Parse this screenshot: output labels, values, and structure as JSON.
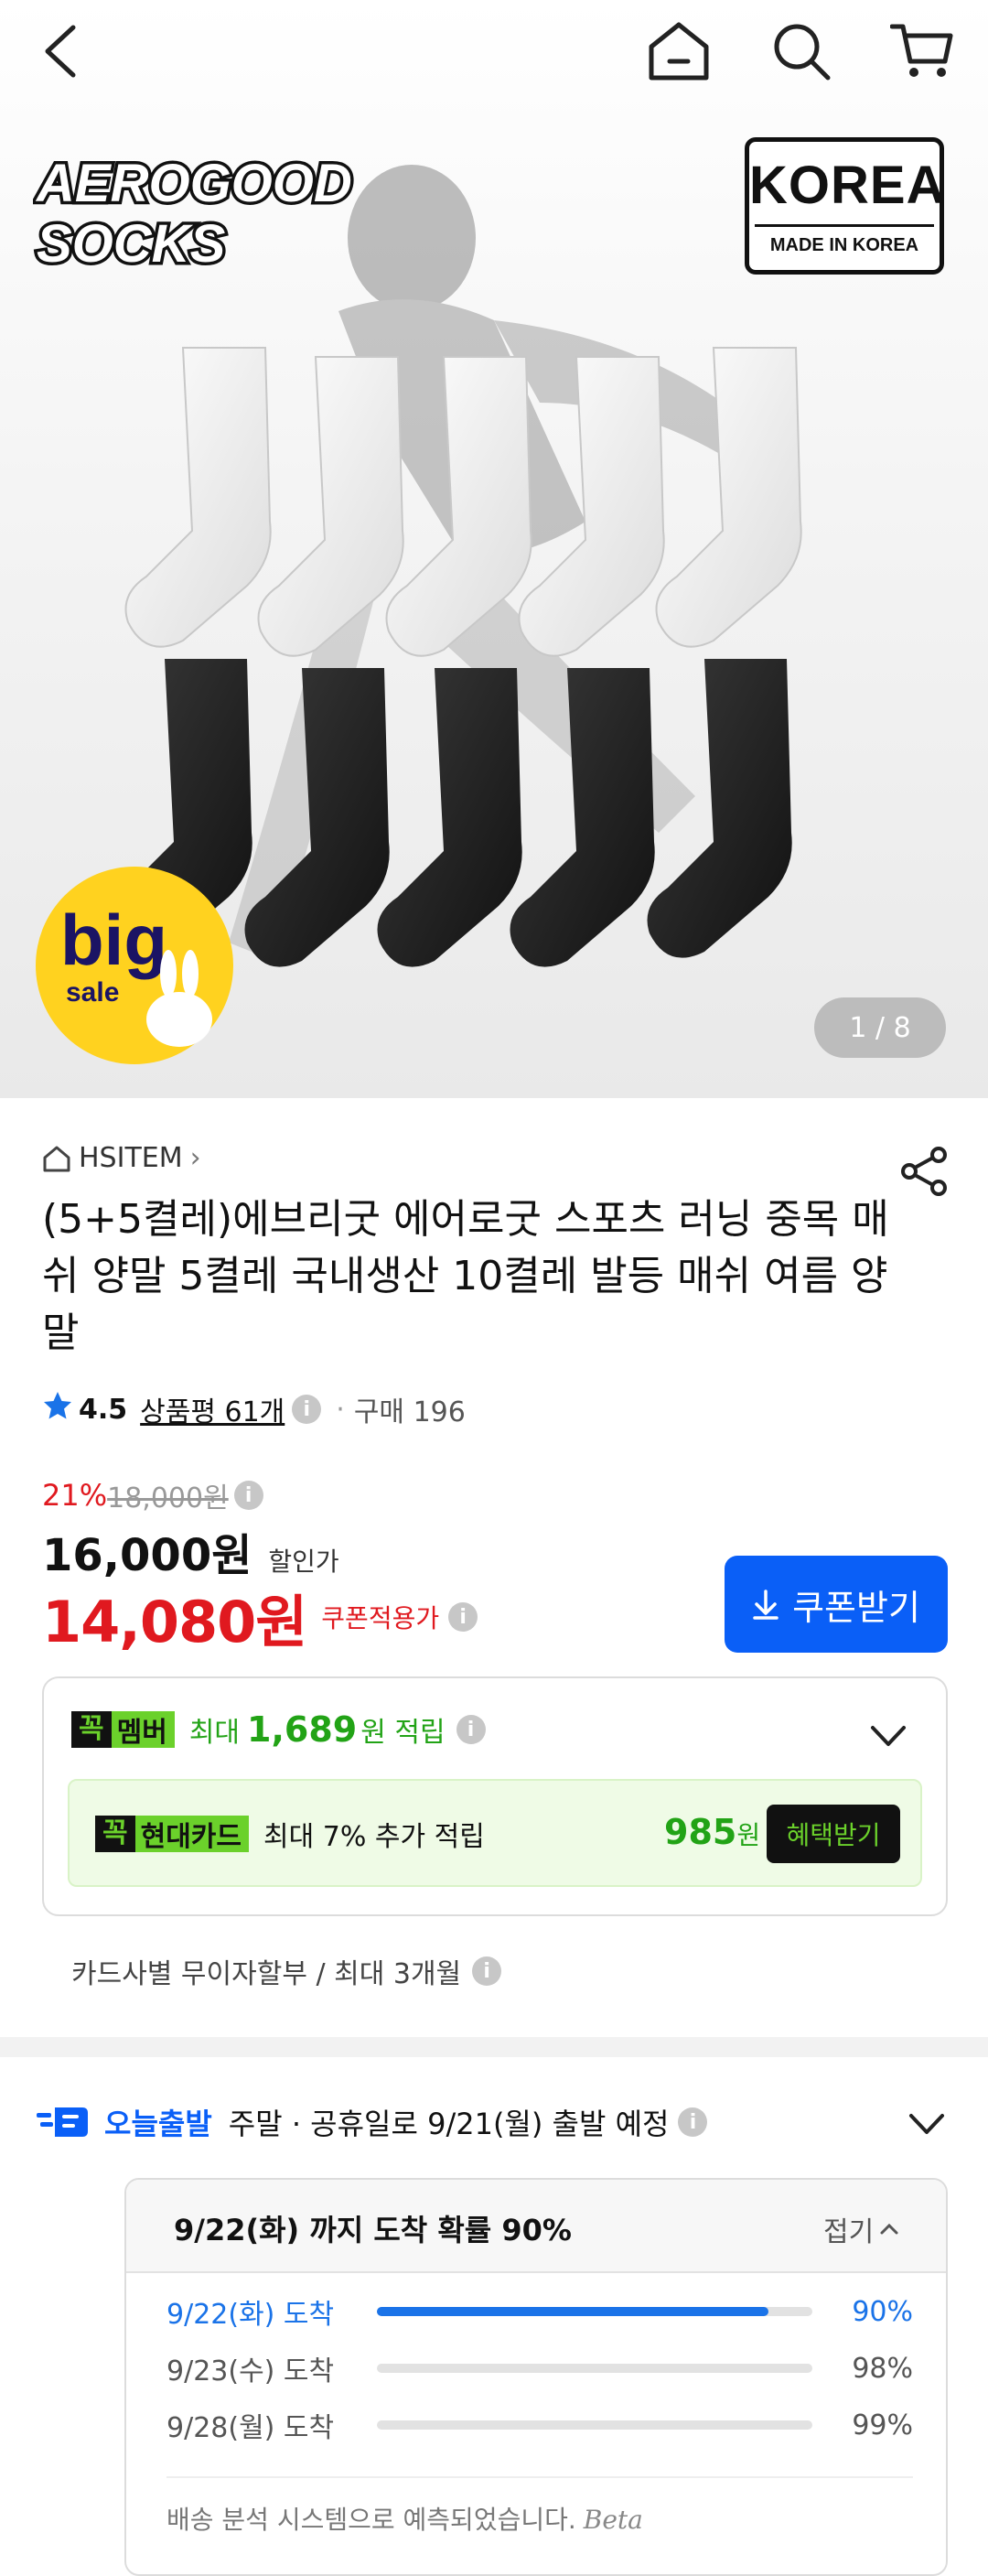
{
  "nav": {
    "icons": [
      "back-icon",
      "home-icon",
      "search-icon",
      "cart-icon"
    ]
  },
  "hero": {
    "brand_line1": "AEROGOOD",
    "brand_line2": "SOCKS",
    "badge_title": "KOREA",
    "badge_sub": "MADE IN KOREA",
    "sale_big": "big",
    "sale_small": "sale",
    "counter": "1 / 8"
  },
  "product": {
    "shop": "HSITEM",
    "title": "(5+5켤레)에브리굿 에어로굿 스포츠 러닝 중목 매쉬 양말 5켤레 국내생산 10켤레 발등 매쉬 여름 양말",
    "rating": "4.5",
    "review_label": "상품평 61개",
    "purchase": "구매 196"
  },
  "price": {
    "discount_pct": "21%",
    "original": "18,000원",
    "sale": "16,000원",
    "sale_label": "할인가",
    "coupon_price": "14,080원",
    "coupon_label": "쿠폰적용가",
    "coupon_button": "쿠폰받기"
  },
  "benefit": {
    "kkok": "꼭",
    "member_tag": "멤버",
    "max_label": "최대",
    "member_amount": "1,689",
    "member_unit": "원 적립",
    "card_tag": "현대카드",
    "card_desc": "최대 7% 추가 적립",
    "card_amount": "985",
    "card_unit": "원",
    "card_button": "혜택받기",
    "installment": "카드사별 무이자할부 / 최대 3개월"
  },
  "delivery": {
    "tag": "오늘출발",
    "message": "주말 · 공휴일로 9/21(월) 출발 예정",
    "head": "9/22(화) 까지 도착 확률 90%",
    "fold": "접기",
    "rows": [
      {
        "date": "9/22(화) 도착",
        "pct": "90%",
        "value": 0.9
      },
      {
        "date": "9/23(수) 도착",
        "pct": "98%",
        "value": 0.98
      },
      {
        "date": "9/28(월) 도착",
        "pct": "99%",
        "value": 0.99
      }
    ],
    "note": "배송 분석 시스템으로 예측되었습니다.",
    "note_beta": "Beta"
  },
  "colors": {
    "accent_blue": "#0a5ff7",
    "sale_red": "#e0191f",
    "green": "#22a316",
    "kkok_green": "#6bd12b"
  }
}
